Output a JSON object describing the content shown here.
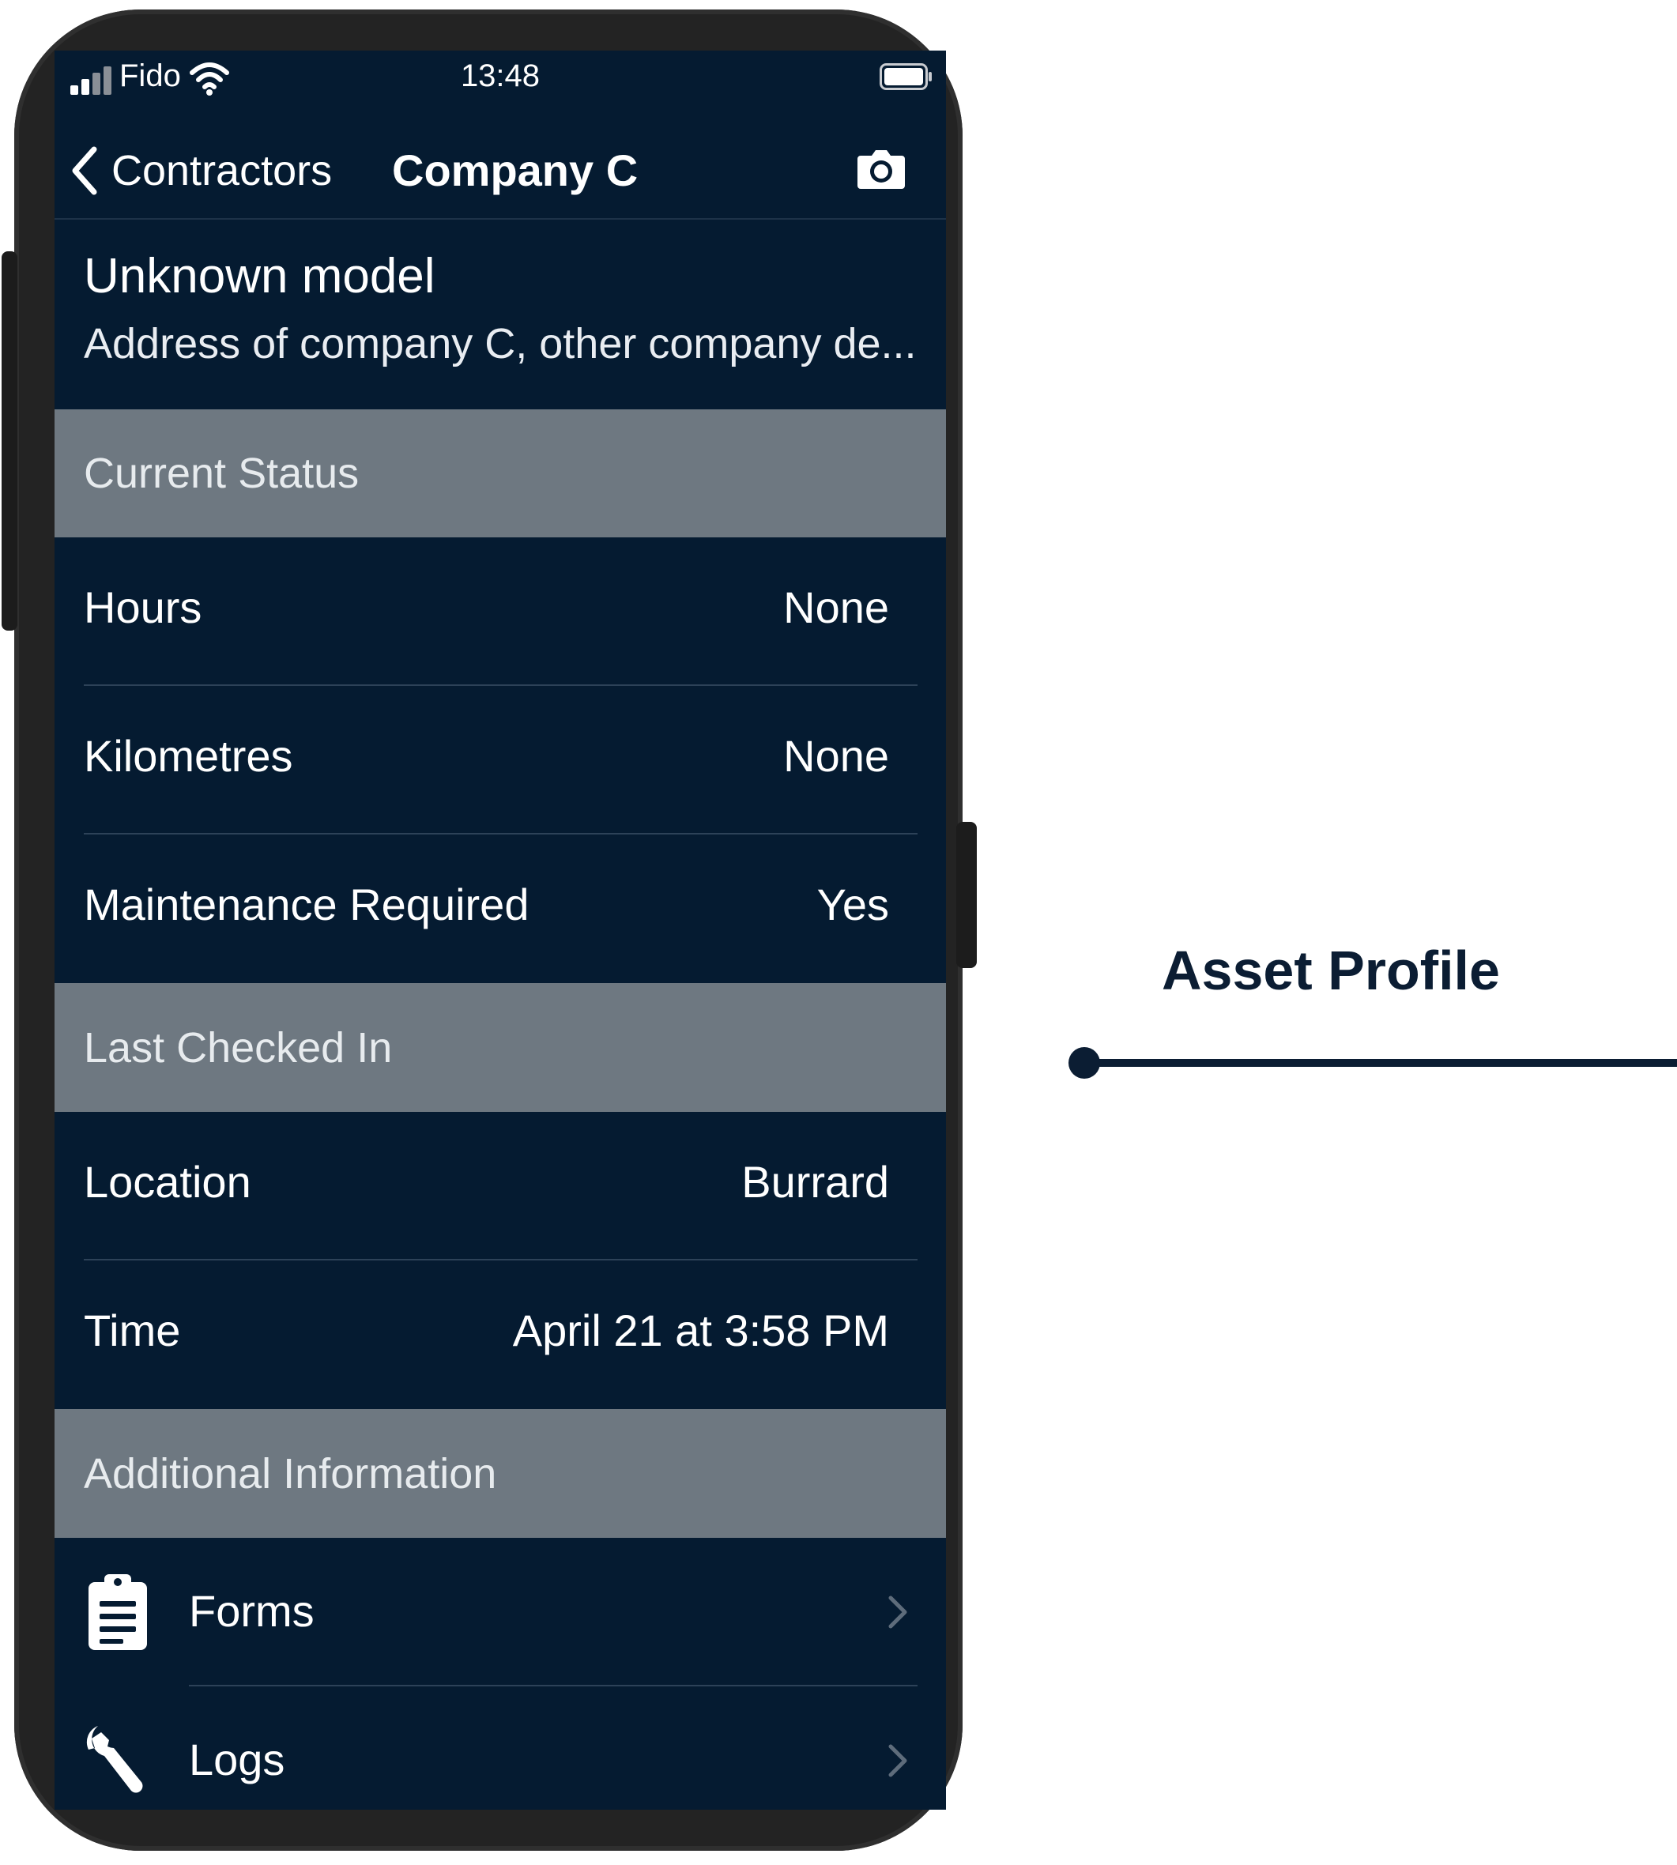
{
  "status_bar": {
    "carrier": "Fido",
    "time": "13:48"
  },
  "nav": {
    "back_label": "Contractors",
    "title": "Company C"
  },
  "asset": {
    "model": "Unknown model",
    "address": "Address of company C, other company de..."
  },
  "sections": {
    "current_status": {
      "header": "Current Status",
      "rows": [
        {
          "label": "Hours",
          "value": "None"
        },
        {
          "label": "Kilometres",
          "value": "None"
        },
        {
          "label": "Maintenance Required",
          "value": "Yes"
        }
      ]
    },
    "last_checked_in": {
      "header": "Last Checked In",
      "rows": [
        {
          "label": "Location",
          "value": "Burrard"
        },
        {
          "label": "Time",
          "value": "April 21 at 3:58 PM"
        }
      ]
    },
    "additional_information": {
      "header": "Additional Information",
      "items": [
        {
          "label": "Forms",
          "icon": "clipboard-icon"
        },
        {
          "label": "Logs",
          "icon": "wrench-icon"
        }
      ]
    }
  },
  "annotation": {
    "title": "Asset Profile"
  },
  "colors": {
    "screen_bg": "#051b31",
    "section_header_bg": "#6e7881",
    "annotation_text": "#0b1d33"
  }
}
